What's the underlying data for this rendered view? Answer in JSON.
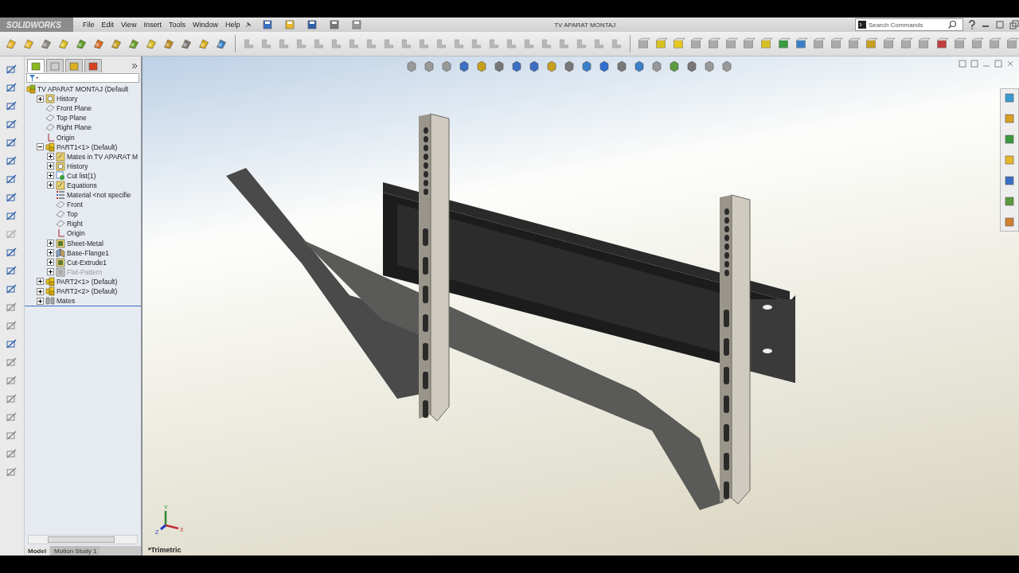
{
  "app": {
    "logo": "SOLIDWORKS"
  },
  "menu": [
    "File",
    "Edit",
    "View",
    "Insert",
    "Tools",
    "Window",
    "Help"
  ],
  "window": {
    "title": "TV APARAT MONTAJ"
  },
  "search": {
    "placeholder": "Search Commands"
  },
  "panel_tabs": [
    {
      "selected": true
    },
    {
      "selected": false
    },
    {
      "selected": false
    },
    {
      "selected": false
    }
  ],
  "tree": {
    "label": "TV APARAT MONTAJ  (Default",
    "kind": "assembly",
    "suppressed": false,
    "children": [
      {
        "label": "History",
        "kind": "history",
        "expanded": false,
        "suppressed": false
      },
      {
        "label": "Front Plane",
        "kind": "plane",
        "suppressed": false
      },
      {
        "label": "Top Plane",
        "kind": "plane",
        "suppressed": false
      },
      {
        "label": "Right Plane",
        "kind": "plane",
        "suppressed": false
      },
      {
        "label": "Origin",
        "kind": "origin",
        "suppressed": false
      },
      {
        "label": "PART1<1> (Default)",
        "kind": "part",
        "expanded": true,
        "suppressed": false,
        "children": [
          {
            "label": "Mates in TV APARAT M",
            "kind": "folder",
            "expanded": false,
            "suppressed": false
          },
          {
            "label": "History",
            "kind": "history",
            "expanded": false,
            "suppressed": false
          },
          {
            "label": "Cut list(1)",
            "kind": "cutlist",
            "expanded": false,
            "suppressed": false
          },
          {
            "label": "Equations",
            "kind": "folder",
            "expanded": false,
            "suppressed": false
          },
          {
            "label": "Material <not specifie",
            "kind": "material",
            "suppressed": false
          },
          {
            "label": "Front",
            "kind": "plane",
            "suppressed": false
          },
          {
            "label": "Top",
            "kind": "plane",
            "suppressed": false
          },
          {
            "label": "Right",
            "kind": "plane",
            "suppressed": false
          },
          {
            "label": "Origin",
            "kind": "origin",
            "suppressed": false
          },
          {
            "label": "Sheet-Metal",
            "kind": "feature",
            "expanded": false,
            "suppressed": false
          },
          {
            "label": "Base-Flange1",
            "kind": "flange",
            "expanded": false,
            "suppressed": false
          },
          {
            "label": "Cut-Extrude1",
            "kind": "feature",
            "expanded": false,
            "suppressed": false
          },
          {
            "label": "Flat-Pattern",
            "kind": "feature",
            "expanded": false,
            "suppressed": true
          }
        ]
      },
      {
        "label": "PART2<1> (Default)",
        "kind": "part",
        "expanded": false,
        "suppressed": false
      },
      {
        "label": "PART2<2> (Default)",
        "kind": "part",
        "expanded": false,
        "suppressed": false
      },
      {
        "label": "Mates",
        "kind": "mates",
        "expanded": false,
        "suppressed": false
      }
    ]
  },
  "view": {
    "name": "*Trimetric",
    "triad": {
      "x": "X",
      "y": "Y",
      "z": "Z"
    }
  },
  "bottom_tabs": [
    {
      "label": "Model",
      "selected": true
    },
    {
      "label": "Motion Study 1",
      "selected": false
    }
  ]
}
